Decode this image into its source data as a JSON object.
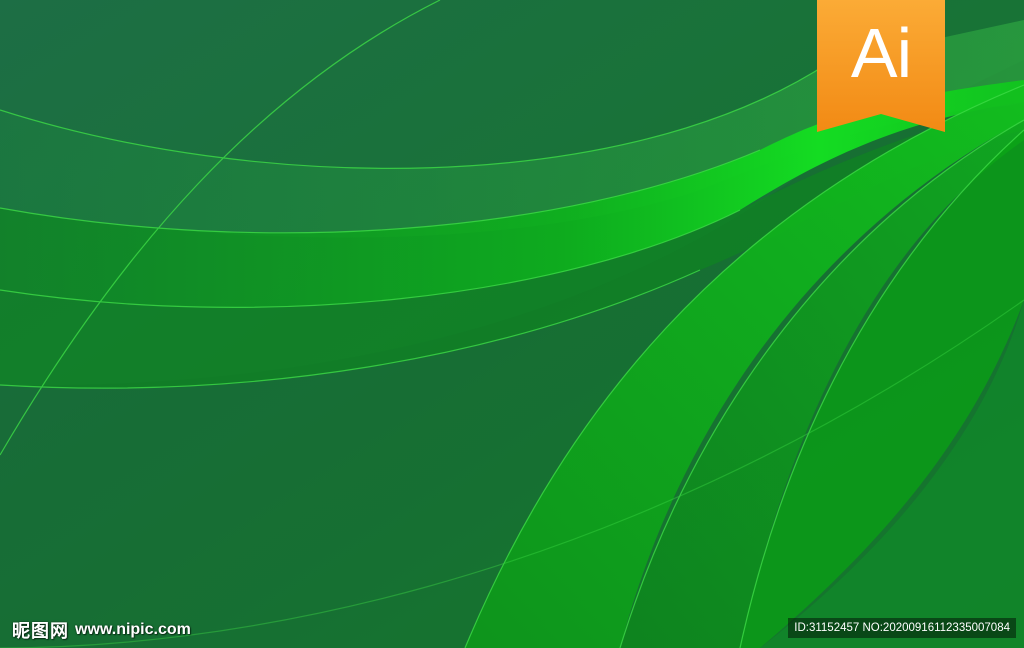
{
  "image": {
    "background_color": "#1a6b3a",
    "accent_colors": [
      "#0fd91f",
      "#0aa614",
      "#1e8a36",
      "#39c13b",
      "#f7941d"
    ],
    "badge": {
      "text": "Ai",
      "color": "#f7941d",
      "icon": "adobe-illustrator-badge-icon"
    },
    "watermark": {
      "brand_cn": "昵图网",
      "brand_url": "www.nipic.com",
      "id_line": "ID:31152457 NO:20200916112335007084"
    }
  }
}
